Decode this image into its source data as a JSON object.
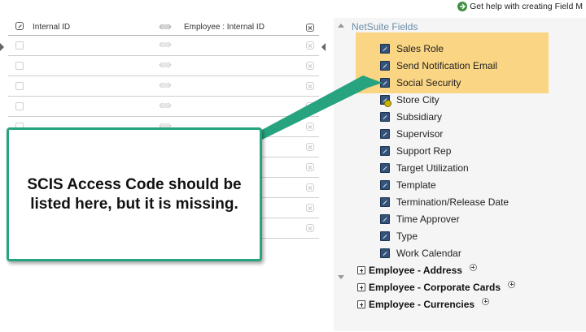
{
  "help": {
    "label": "Get help with creating Field M"
  },
  "mapping": {
    "header": {
      "left": "Internal ID",
      "right": "Employee : Internal ID"
    },
    "empty_rows": 10
  },
  "fields_panel": {
    "title": "NetSuite Fields",
    "highlighted_fields": [
      "Sales Role",
      "Send Notification Email",
      "Social Security"
    ],
    "fields": [
      "Store City",
      "Subsidiary",
      "Supervisor",
      "Support Rep",
      "Target Utilization",
      "Template",
      "Termination/Release Date",
      "Time Approver",
      "Type",
      "Work Calendar"
    ],
    "groups": [
      "Employee - Address",
      "Employee - Corporate Cards",
      "Employee - Currencies"
    ]
  },
  "callout": {
    "text": "SCIS Access Code should be listed here, but it is missing."
  },
  "colors": {
    "highlight": "#fad583",
    "callout_border": "#27a37f",
    "panel_title": "#6a8fa8"
  }
}
